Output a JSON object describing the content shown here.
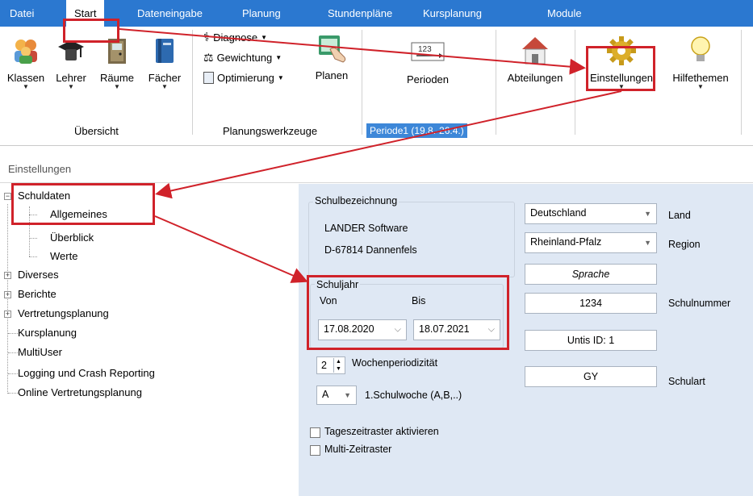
{
  "menu": {
    "tabs": [
      {
        "label": "Datei"
      },
      {
        "label": "Start"
      },
      {
        "label": "Dateneingabe"
      },
      {
        "label": "Planung"
      },
      {
        "label": "Stundenpläne"
      },
      {
        "label": "Kursplanung"
      },
      {
        "label": "Module"
      }
    ],
    "active_tab": "Start"
  },
  "ribbon": {
    "overview": {
      "buttons": [
        "Klassen",
        "Lehrer",
        "Räume",
        "Fächer"
      ],
      "group_label": "Übersicht"
    },
    "tools": {
      "items": [
        "Diagnose",
        "Gewichtung",
        "Optimierung"
      ],
      "plan_label": "Planen",
      "group_label": "Planungswerkzeuge"
    },
    "periods": {
      "label": "Perioden",
      "current": "Periode1 (19.8.-26.4.)"
    },
    "departments": {
      "label": "Abteilungen"
    },
    "settings": {
      "label": "Einstellungen"
    },
    "help": {
      "label": "Hilfethemen"
    }
  },
  "panel": {
    "title": "Einstellungen"
  },
  "tree": {
    "items": [
      {
        "label": "Schuldaten"
      },
      {
        "label": "Allgemeines"
      },
      {
        "label": "Überblick"
      },
      {
        "label": "Werte"
      },
      {
        "label": "Diverses"
      },
      {
        "label": "Berichte"
      },
      {
        "label": "Vertretungsplanung"
      },
      {
        "label": "Kursplanung"
      },
      {
        "label": "MultiUser"
      },
      {
        "label": "Logging und Crash Reporting"
      },
      {
        "label": "Online Vertretungsplanung"
      }
    ]
  },
  "settings": {
    "school_name": {
      "legend": "Schulbezeichnung",
      "line1": "LANDER Software",
      "line2": "D-67814 Dannenfels"
    },
    "country": {
      "value": "Deutschland",
      "label": "Land"
    },
    "region": {
      "value": "Rheinland-Pfalz",
      "label": "Region"
    },
    "language_button": "Sprache",
    "school_number": {
      "value": "1234",
      "label": "Schulnummer"
    },
    "untis_id": "Untis ID: 1",
    "school_type": {
      "value": "GY",
      "label": "Schulart"
    },
    "school_year": {
      "legend": "Schuljahr",
      "from_label": "Von",
      "to_label": "Bis",
      "from_value": "17.08.2020",
      "to_value": "18.07.2021"
    },
    "weekly_period": {
      "value": "2",
      "label": "Wochenperiodizität"
    },
    "first_week": {
      "value": "A",
      "label": "1.Schulwoche (A,B,..)"
    },
    "checkboxes": [
      {
        "label": "Tageszeitraster aktivieren",
        "checked": false
      },
      {
        "label": "Multi-Zeitraster",
        "checked": false
      }
    ]
  },
  "colors": {
    "highlight": "#d0222a",
    "menubar": "#2b78d0",
    "pane": "#dfe8f4"
  }
}
